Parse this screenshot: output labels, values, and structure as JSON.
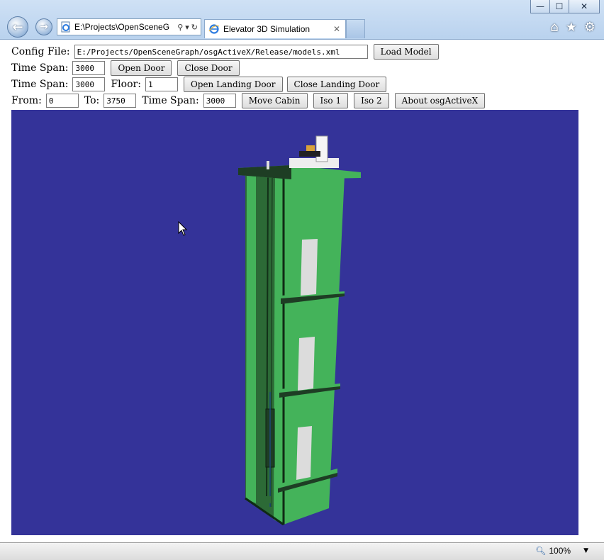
{
  "window": {
    "minimize": "—",
    "maximize": "☐",
    "close": "✕"
  },
  "nav": {
    "back_icon": "←",
    "forward_icon": "→"
  },
  "address": {
    "value": "E:\\Projects\\OpenSceneG",
    "search_icon": "⚲",
    "dropdown_icon": "▾",
    "refresh_icon": "↻"
  },
  "tab": {
    "title": "Elevator 3D Simulation",
    "close_icon": "✕"
  },
  "tools": {
    "home_icon": "⌂",
    "favorites_icon": "★",
    "settings_icon": "⚙"
  },
  "form": {
    "config": {
      "label": "Config File:",
      "value": "E:/Projects/OpenSceneGraph/osgActiveX/Release/models.xml",
      "button": "Load Model"
    },
    "door": {
      "label": "Time Span:",
      "value": "3000",
      "open": "Open Door",
      "close": "Close Door"
    },
    "landing": {
      "label": "Time Span:",
      "value": "3000",
      "floor_label": "Floor:",
      "floor_value": "1",
      "open": "Open Landing Door",
      "close": "Close Landing Door"
    },
    "cabin": {
      "from_label": "From:",
      "from_value": "0",
      "to_label": "To:",
      "to_value": "3750",
      "span_label": "Time Span:",
      "span_value": "3000",
      "move": "Move Cabin",
      "iso1": "Iso 1",
      "iso2": "Iso 2",
      "about": "About osgActiveX"
    }
  },
  "viewport": {
    "background": "#343399",
    "shaft_color": "#44b35a",
    "shaft_dark": "#1e3d24",
    "door_color": "#dcdcdc"
  },
  "status": {
    "zoom": "100%"
  }
}
